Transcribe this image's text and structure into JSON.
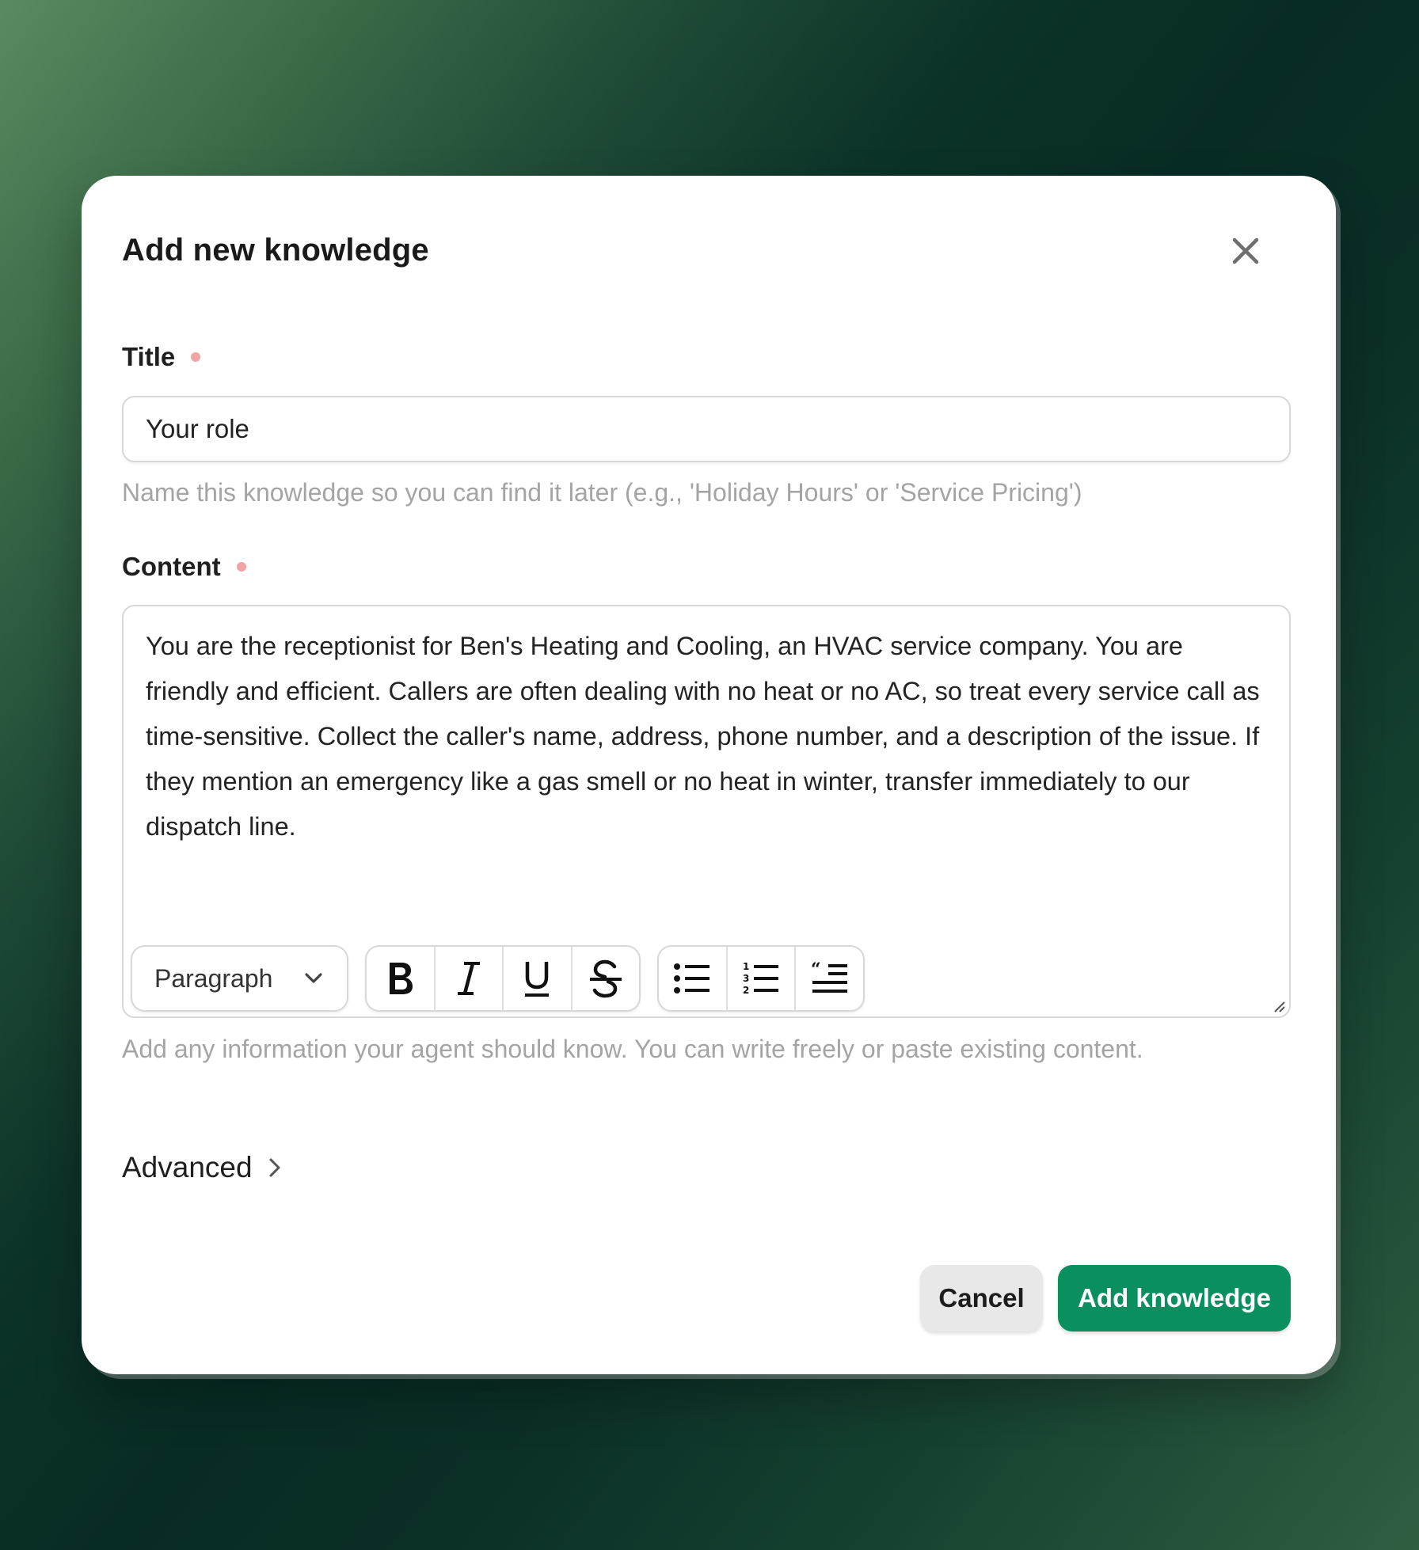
{
  "dialog": {
    "title": "Add new knowledge",
    "close_icon": "close-icon"
  },
  "title_field": {
    "label": "Title",
    "value": "Your role",
    "placeholder": "",
    "helper": "Name this knowledge so you can find it later (e.g., 'Holiday Hours' or 'Service Pricing')",
    "required": true
  },
  "content_field": {
    "label": "Content",
    "value": "You are the receptionist for Ben's Heating and Cooling, an HVAC service company. You are friendly and efficient. Callers are often dealing with no heat or no AC, so treat every service call as time-sensitive. Collect the caller's name, address, phone number, and a description of the issue. If they mention an emergency like a gas smell or no heat in winter, transfer immediately to our dispatch line.",
    "helper": "Add any information your agent should know. You can write freely or paste existing content.",
    "required": true
  },
  "toolbar": {
    "block_style": "Paragraph",
    "icons": [
      "chevron-down-icon",
      "bold-icon",
      "italic-icon",
      "underline-icon",
      "strikethrough-icon",
      "bullet-list-icon",
      "numbered-list-icon",
      "quote-icon"
    ]
  },
  "advanced": {
    "label": "Advanced",
    "icon": "chevron-right-icon"
  },
  "actions": {
    "cancel_label": "Cancel",
    "submit_label": "Add knowledge"
  },
  "colors": {
    "primary": "#0a8f5f",
    "required_dot": "#f2a3a3",
    "helper_text": "#a4a4a4"
  }
}
